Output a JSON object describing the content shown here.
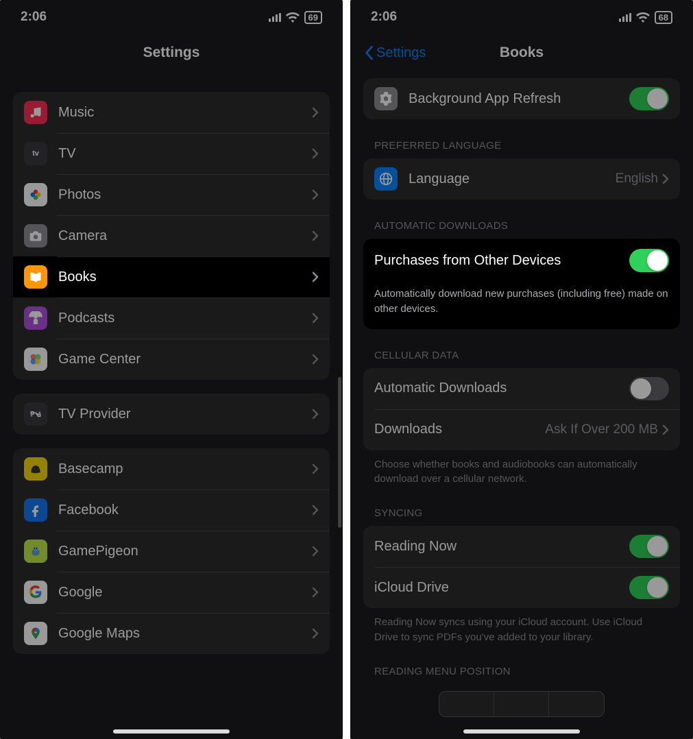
{
  "left": {
    "status": {
      "time": "2:06",
      "battery": "69"
    },
    "title": "Settings",
    "group1": [
      {
        "label": "Music",
        "icon_bg": "#ff2d55",
        "icon": "music"
      },
      {
        "label": "TV",
        "icon_bg": "#3a3a3c",
        "icon": "tv"
      },
      {
        "label": "Photos",
        "icon_bg": "#ffffff",
        "icon": "photos"
      },
      {
        "label": "Camera",
        "icon_bg": "#8e8e93",
        "icon": "camera"
      },
      {
        "label": "Books",
        "icon_bg": "#ff9500",
        "icon": "book",
        "highlight": true
      },
      {
        "label": "Podcasts",
        "icon_bg": "#af52de",
        "icon": "podcasts"
      },
      {
        "label": "Game Center",
        "icon_bg": "#ffffff",
        "icon": "gamecenter"
      }
    ],
    "group2": [
      {
        "label": "TV Provider",
        "icon_bg": "#3a3a3c",
        "icon": "cable"
      }
    ],
    "group3": [
      {
        "label": "Basecamp",
        "icon_bg": "#f5d90a",
        "icon": "basecamp"
      },
      {
        "label": "Facebook",
        "icon_bg": "#1877f2",
        "icon": "facebook"
      },
      {
        "label": "GamePigeon",
        "icon_bg": "#bfe84a",
        "icon": "pigeon"
      },
      {
        "label": "Google",
        "icon_bg": "#ffffff",
        "icon": "google"
      },
      {
        "label": "Google Maps",
        "icon_bg": "#ffffff",
        "icon": "gmaps"
      }
    ]
  },
  "right": {
    "status": {
      "time": "2:06",
      "battery": "68"
    },
    "back_label": "Settings",
    "title": "Books",
    "bg_refresh": {
      "label": "Background App Refresh",
      "icon_bg": "#8e8e93"
    },
    "lang_header": "PREFERRED LANGUAGE",
    "language": {
      "label": "Language",
      "value": "English",
      "icon_bg": "#0a84ff"
    },
    "auto_header": "AUTOMATIC DOWNLOADS",
    "purchases": {
      "label": "Purchases from Other Devices"
    },
    "purchases_footer": "Automatically download new purchases (including free) made on other devices.",
    "cell_header": "CELLULAR DATA",
    "cell_auto": {
      "label": "Automatic Downloads"
    },
    "cell_downloads": {
      "label": "Downloads",
      "value": "Ask If Over 200 MB"
    },
    "cell_footer": "Choose whether books and audiobooks can automatically download over a cellular network.",
    "sync_header": "SYNCING",
    "sync_reading": {
      "label": "Reading Now"
    },
    "sync_icloud": {
      "label": "iCloud Drive"
    },
    "sync_footer": "Reading Now syncs using your iCloud account. Use iCloud Drive to sync PDFs you've added to your library.",
    "menu_header": "READING MENU POSITION"
  }
}
